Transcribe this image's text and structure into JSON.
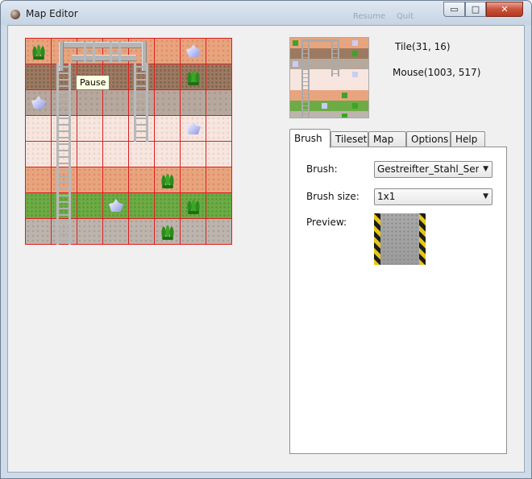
{
  "window": {
    "title": "Map Editor",
    "ghost_buttons": [
      "Resume",
      "Quit"
    ]
  },
  "controls": {
    "minimize": "▭",
    "maximize": "□",
    "close": "✕"
  },
  "map": {
    "tooltip": "Pause",
    "rows": [
      [
        "sand-plant",
        "sand",
        "sand",
        "sand",
        "sand",
        "sand",
        "sand-crystal",
        "sand"
      ],
      [
        "dirt",
        "dirt",
        "dirt",
        "dirt",
        "dirt",
        "dirt",
        "dirt-plant",
        "dirt"
      ],
      [
        "stone-crystal",
        "stone",
        "stone",
        "stone",
        "stone",
        "stone",
        "stone",
        "stone"
      ],
      [
        "snow",
        "snow",
        "snow",
        "snow",
        "snow",
        "snow",
        "snow-crystal",
        "snow"
      ],
      [
        "snow",
        "snow",
        "snow",
        "snow",
        "snow",
        "snow",
        "snow",
        "snow"
      ],
      [
        "sand",
        "sand",
        "sand",
        "sand",
        "sand",
        "sand-plant",
        "sand",
        "sand"
      ],
      [
        "grass",
        "grass",
        "grass",
        "grass-crystal",
        "grass",
        "grass",
        "grass-plant",
        "grass"
      ],
      [
        "rock",
        "rock",
        "rock",
        "rock",
        "rock",
        "rock-plant",
        "rock",
        "rock"
      ]
    ]
  },
  "info": {
    "tile": "Tile(31, 16)",
    "mouse": "Mouse(1003, 517)"
  },
  "tabs": [
    "Brush",
    "Tileset",
    "Map",
    "Options",
    "Help"
  ],
  "brush_panel": {
    "brush_label": "Brush:",
    "brush_value": "Gestreifter_Stahl_Senkrecht",
    "size_label": "Brush size:",
    "size_value": "1x1",
    "preview_label": "Preview:"
  }
}
